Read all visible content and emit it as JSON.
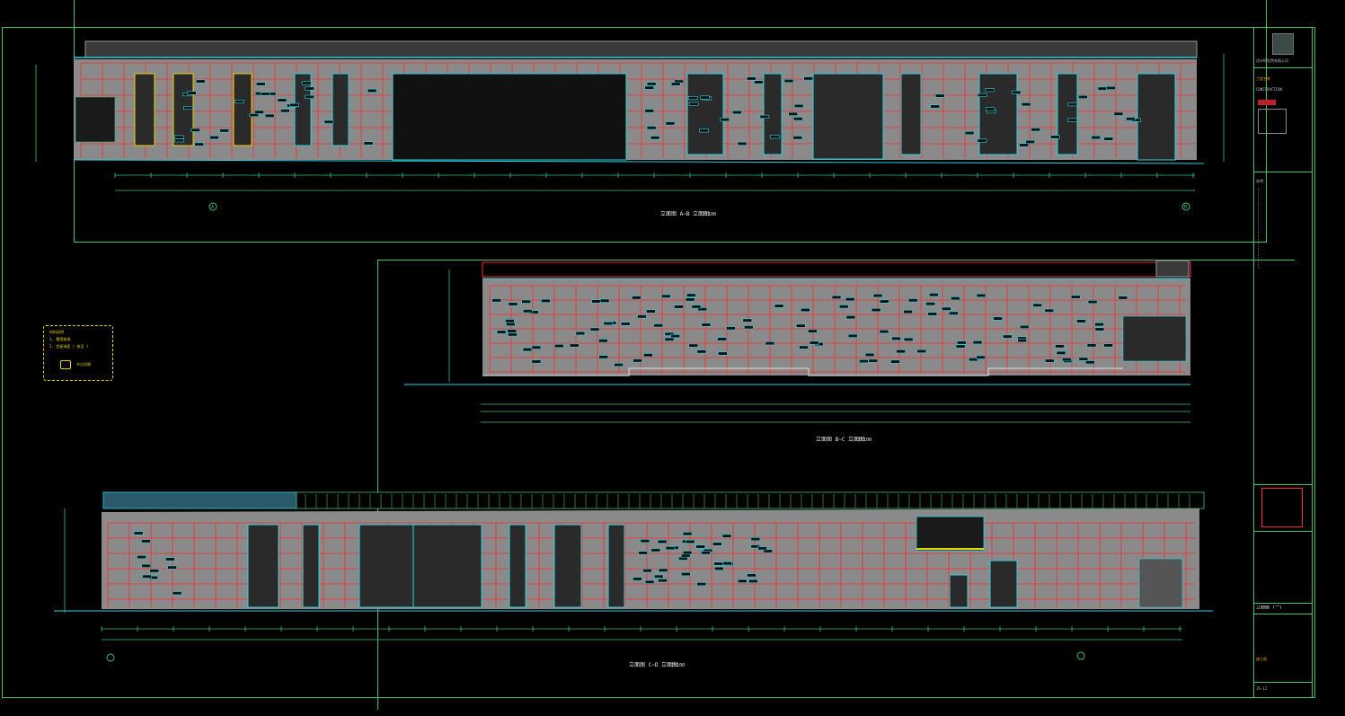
{
  "drawing": {
    "elevation_1_label": "立面图 A~B 立面图",
    "elevation_2_label": "立面图 B~C 立面图",
    "elevation_3_label": "立面图 C~D 立面图",
    "scale": "1:100",
    "grid_left": "A",
    "grid_right": "B"
  },
  "legend": {
    "title": "材料说明",
    "line1": "1. 幕墙玻璃",
    "line2": "2. 铝板饰面 ( 参见 )",
    "line3": "节点详图"
  },
  "title_block": {
    "company": "设计研究院有限公司",
    "project_label": "工程名称",
    "project_en": "CONSTRUCTION",
    "notes_label": "说明",
    "drawing_name": "立面图 (一)",
    "sheet_no": "JS-12",
    "phase": "施工图"
  },
  "colors": {
    "background": "#000000",
    "frame": "#3fc06a",
    "facade": "#8a8a8a",
    "grid": "#ff2a2a",
    "window": "#29d4e0",
    "highlight": "#e5d300"
  }
}
